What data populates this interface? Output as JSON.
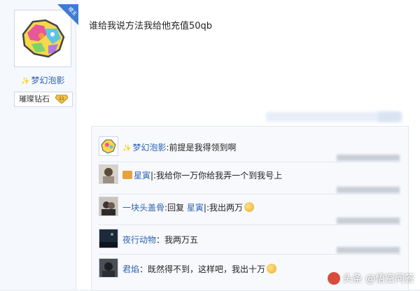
{
  "post": {
    "author": "梦幻泡影",
    "badge": "楼主",
    "level_label": "璀璨钻石",
    "level_number": "11",
    "content": "谁给我说方法我给他充值50qb"
  },
  "replies": [
    {
      "name": "梦幻泡影",
      "sep": ":",
      "text": "前提是我得领到啊",
      "smiley": false,
      "crown": false
    },
    {
      "name": "星寅",
      "sep": "|:",
      "text": "我给你一万你给我弄一个到我号上",
      "smiley": false,
      "crown": true
    },
    {
      "name": "一块头盖骨",
      "sep": ":",
      "text": "回复",
      "mention": "星寅",
      "text2": "|:我出两万",
      "smiley": true,
      "crown": false
    },
    {
      "name": "夜行动物",
      "sep": "：",
      "text": "我两万五",
      "smiley": false,
      "crown": false
    },
    {
      "name": "君焰",
      "sep": "：",
      "text": "既然得不到，这样吧，我出十万",
      "smiley": true,
      "crown": false
    }
  ],
  "watermark": "头条 @悟空问答",
  "icons": {
    "corner": "host-badge-icon",
    "level": "diamond-level-icon",
    "smiley": "smiley-emoji-icon"
  },
  "colors": {
    "link": "#2d64b3",
    "badge": "#3d7cd6"
  }
}
